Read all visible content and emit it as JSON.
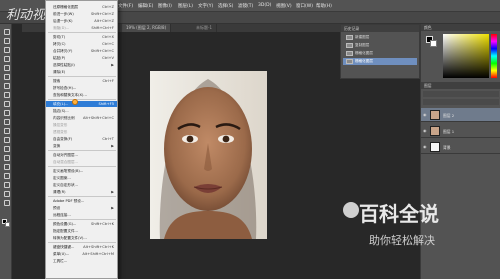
{
  "menubar": {
    "items": [
      "文件(F)",
      "编辑(E)",
      "图像(I)",
      "图层(L)",
      "文字(Y)",
      "选择(S)",
      "滤镜(T)",
      "3D(D)",
      "视图(V)",
      "窗口(W)",
      "帮助(H)"
    ]
  },
  "tabs": [
    {
      "label": "19% (图层 2, RGB/8)"
    },
    {
      "label": "未标题-1"
    }
  ],
  "edit_menu": {
    "items": [
      {
        "label": "还原栅格化图层",
        "shortcut": "Ctrl+Z"
      },
      {
        "label": "前进一步(W)",
        "shortcut": "Shift+Ctrl+Z"
      },
      {
        "label": "后退一步(K)",
        "shortcut": "Alt+Ctrl+Z"
      },
      {
        "label": "渐隐(D)...",
        "shortcut": "Shift+Ctrl+F"
      },
      {
        "label": "剪切(T)",
        "shortcut": "Ctrl+X"
      },
      {
        "label": "拷贝(C)",
        "shortcut": "Ctrl+C"
      },
      {
        "label": "合并拷贝(Y)",
        "shortcut": "Shift+Ctrl+C"
      },
      {
        "label": "粘贴(P)",
        "shortcut": "Ctrl+V"
      },
      {
        "label": "选择性粘贴(I)",
        "shortcut": ""
      },
      {
        "label": "清除(E)",
        "shortcut": ""
      },
      {
        "label": "搜索",
        "shortcut": "Ctrl+F"
      },
      {
        "label": "拼写检查(H)...",
        "shortcut": ""
      },
      {
        "label": "查找和替换文本(X)...",
        "shortcut": ""
      },
      {
        "label": "填充(L)...",
        "shortcut": "Shift+F5"
      },
      {
        "label": "描边(S)...",
        "shortcut": ""
      },
      {
        "label": "内容识别比例",
        "shortcut": "Alt+Shift+Ctrl+C"
      },
      {
        "label": "操控变形",
        "shortcut": ""
      },
      {
        "label": "透视变形",
        "shortcut": ""
      },
      {
        "label": "自由变换(F)",
        "shortcut": "Ctrl+T"
      },
      {
        "label": "变换",
        "shortcut": ""
      },
      {
        "label": "自动对齐图层...",
        "shortcut": ""
      },
      {
        "label": "自动混合图层...",
        "shortcut": ""
      },
      {
        "label": "定义画笔预设(B)...",
        "shortcut": ""
      },
      {
        "label": "定义图案...",
        "shortcut": ""
      },
      {
        "label": "定义自定形状...",
        "shortcut": ""
      },
      {
        "label": "清理(R)",
        "shortcut": ""
      },
      {
        "label": "Adobe PDF 预设...",
        "shortcut": ""
      },
      {
        "label": "预设",
        "shortcut": ""
      },
      {
        "label": "远程连接...",
        "shortcut": ""
      },
      {
        "label": "颜色设置(G)...",
        "shortcut": "Shift+Ctrl+K"
      },
      {
        "label": "指定配置文件...",
        "shortcut": ""
      },
      {
        "label": "转换为配置文件(V)...",
        "shortcut": ""
      },
      {
        "label": "键盘快捷键...",
        "shortcut": "Alt+Shift+Ctrl+K"
      },
      {
        "label": "菜单(U)...",
        "shortcut": "Alt+Shift+Ctrl+M"
      },
      {
        "label": "工具栏...",
        "shortcut": ""
      }
    ]
  },
  "history_panel": {
    "title": "历史记录",
    "rows": [
      "新建图层",
      "复制图层",
      "栅格化图层",
      "栅格化图层"
    ]
  },
  "color_panel": {
    "title": "颜色"
  },
  "layers_panel": {
    "title": "图层",
    "layers": [
      {
        "name": "图层 2"
      },
      {
        "name": "图层 1"
      },
      {
        "name": "背景"
      }
    ]
  },
  "watermark": {
    "top_left": "利动视频",
    "brand_main": "百科全说",
    "brand_sub": "助你轻松解决"
  }
}
